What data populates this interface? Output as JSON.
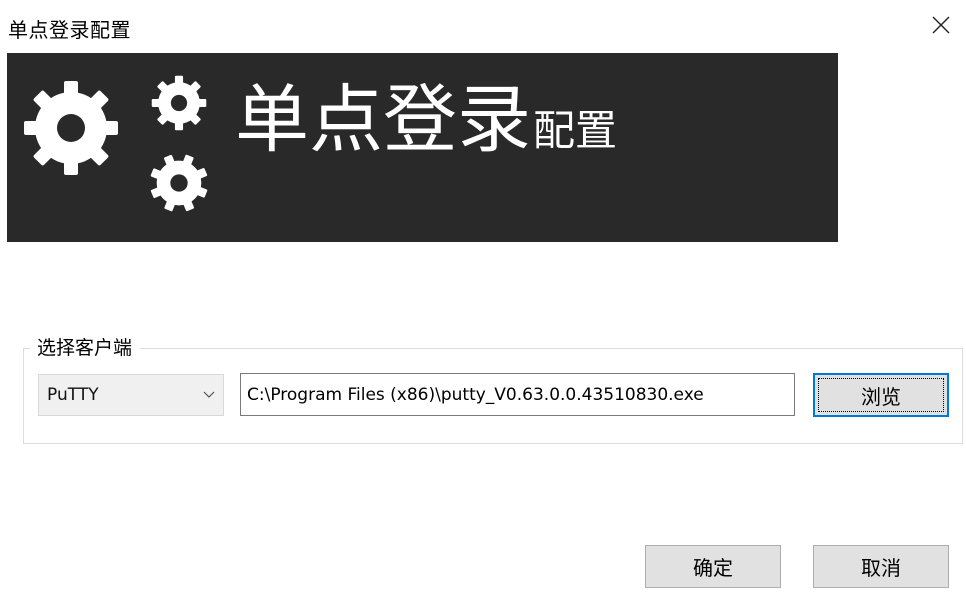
{
  "window": {
    "title": "单点登录配置",
    "close_icon": "close-icon"
  },
  "banner": {
    "title_main": "单点登录",
    "title_sub": "配置",
    "background_color": "#292929",
    "icon": "gears-icon"
  },
  "client_group": {
    "legend": "选择客户端",
    "client_select": {
      "selected": "PuTTY",
      "icon": "chevron-down-icon"
    },
    "path_input": {
      "value": "C:\\Program Files (x86)\\putty_V0.63.0.0.43510830.exe"
    },
    "browse_label": "浏览"
  },
  "footer": {
    "ok_label": "确定",
    "cancel_label": "取消"
  }
}
